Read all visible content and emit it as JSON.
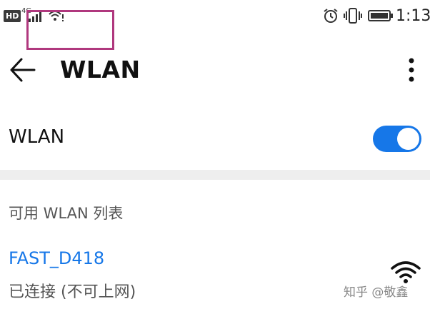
{
  "status_bar": {
    "hd_badge": "HD",
    "network_type": "4G",
    "time": "1:13",
    "icons": [
      "signal-icon",
      "wifi-icon",
      "alarm-icon",
      "vibrate-icon",
      "battery-icon"
    ]
  },
  "app_bar": {
    "title": "WLAN",
    "icons": [
      "back-arrow-icon",
      "more-vert-icon"
    ]
  },
  "wlan_toggle": {
    "label": "WLAN",
    "on": true
  },
  "available_networks": {
    "header": "可用 WLAN 列表",
    "items": [
      {
        "name": "FAST_D418",
        "status": "已连接 (不可上网)",
        "icon": "wifi-icon"
      }
    ]
  },
  "watermark": "知乎 @敬鑫",
  "colors": {
    "accent": "#1677e8",
    "annotation": "#b0387e",
    "divider": "#eeeeee"
  }
}
